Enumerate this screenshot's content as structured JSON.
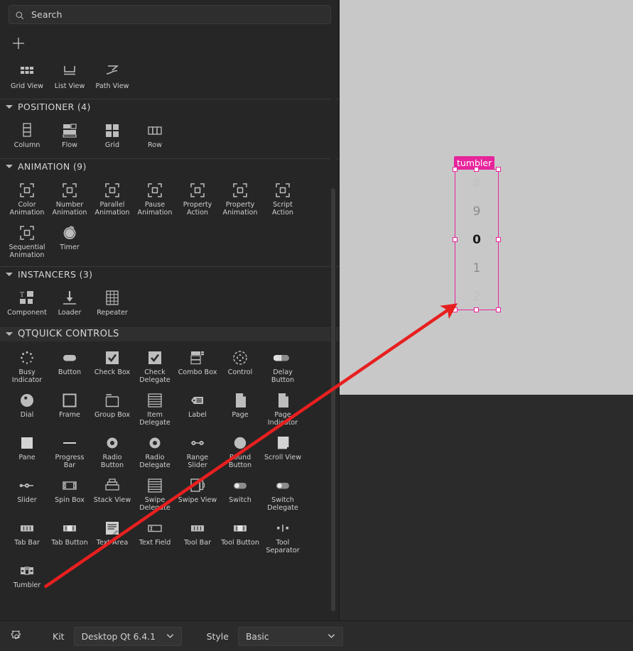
{
  "search": {
    "placeholder": "Search",
    "icon": "search-icon"
  },
  "toolbar": {
    "add_icon": "plus-icon"
  },
  "library": {
    "partial_top_row": {
      "items": [
        {
          "label": "Grid View",
          "icon": "grid-view-icon"
        },
        {
          "label": "List View",
          "icon": "list-view-icon"
        },
        {
          "label": "Path View",
          "icon": "path-view-icon"
        }
      ]
    },
    "sections": [
      {
        "title": "POSITIONER (4)",
        "expanded": true,
        "items": [
          {
            "label": "Column",
            "icon": "column-icon"
          },
          {
            "label": "Flow",
            "icon": "flow-icon"
          },
          {
            "label": "Grid",
            "icon": "grid-icon"
          },
          {
            "label": "Row",
            "icon": "row-icon"
          }
        ]
      },
      {
        "title": "ANIMATION (9)",
        "expanded": true,
        "items": [
          {
            "label": "Color Animation",
            "icon": "animation-bracket-icon"
          },
          {
            "label": "Number Animation",
            "icon": "animation-bracket-icon"
          },
          {
            "label": "Parallel Animation",
            "icon": "animation-bracket-icon"
          },
          {
            "label": "Pause Animation",
            "icon": "animation-bracket-icon"
          },
          {
            "label": "Property Action",
            "icon": "animation-bracket-icon"
          },
          {
            "label": "Property Animation",
            "icon": "animation-bracket-icon"
          },
          {
            "label": "Script Action",
            "icon": "animation-bracket-icon"
          },
          {
            "label": "Sequential Animation",
            "icon": "animation-bracket-icon"
          },
          {
            "label": "Timer",
            "icon": "timer-icon"
          }
        ]
      },
      {
        "title": "INSTANCERS (3)",
        "expanded": true,
        "items": [
          {
            "label": "Component",
            "icon": "component-icon"
          },
          {
            "label": "Loader",
            "icon": "loader-icon"
          },
          {
            "label": "Repeater",
            "icon": "repeater-icon"
          }
        ]
      },
      {
        "title": "QTQUICK CONTROLS",
        "expanded": true,
        "items": [
          {
            "label": "Busy Indicator",
            "icon": "busy-indicator-icon"
          },
          {
            "label": "Button",
            "icon": "button-icon"
          },
          {
            "label": "Check Box",
            "icon": "check-box-icon"
          },
          {
            "label": "Check Delegate",
            "icon": "check-delegate-icon"
          },
          {
            "label": "Combo Box",
            "icon": "combo-box-icon"
          },
          {
            "label": "Control",
            "icon": "control-icon"
          },
          {
            "label": "Delay Button",
            "icon": "delay-button-icon"
          },
          {
            "label": "Dial",
            "icon": "dial-icon"
          },
          {
            "label": "Frame",
            "icon": "frame-icon"
          },
          {
            "label": "Group Box",
            "icon": "group-box-icon"
          },
          {
            "label": "Item Delegate",
            "icon": "item-delegate-icon"
          },
          {
            "label": "Label",
            "icon": "label-icon"
          },
          {
            "label": "Page",
            "icon": "page-icon"
          },
          {
            "label": "Page Indicator",
            "icon": "page-indicator-icon"
          },
          {
            "label": "Pane",
            "icon": "pane-icon"
          },
          {
            "label": "Progress Bar",
            "icon": "progress-bar-icon"
          },
          {
            "label": "Radio Button",
            "icon": "radio-button-icon"
          },
          {
            "label": "Radio Delegate",
            "icon": "radio-delegate-icon"
          },
          {
            "label": "Range Slider",
            "icon": "range-slider-icon"
          },
          {
            "label": "Round Button",
            "icon": "round-button-icon"
          },
          {
            "label": "Scroll View",
            "icon": "scroll-view-icon"
          },
          {
            "label": "Slider",
            "icon": "slider-icon"
          },
          {
            "label": "Spin Box",
            "icon": "spin-box-icon"
          },
          {
            "label": "Stack View",
            "icon": "stack-view-icon"
          },
          {
            "label": "Swipe Delegate",
            "icon": "swipe-delegate-icon"
          },
          {
            "label": "Swipe View",
            "icon": "swipe-view-icon"
          },
          {
            "label": "Switch",
            "icon": "switch-icon"
          },
          {
            "label": "Switch Delegate",
            "icon": "switch-delegate-icon"
          },
          {
            "label": "Tab Bar",
            "icon": "tab-bar-icon"
          },
          {
            "label": "Tab Button",
            "icon": "tab-button-icon"
          },
          {
            "label": "Text Area",
            "icon": "text-area-icon"
          },
          {
            "label": "Text Field",
            "icon": "text-field-icon"
          },
          {
            "label": "Tool Bar",
            "icon": "tool-bar-icon"
          },
          {
            "label": "Tool Button",
            "icon": "tool-button-icon"
          },
          {
            "label": "Tool Separator",
            "icon": "tool-separator-icon"
          },
          {
            "label": "Tumbler",
            "icon": "tumbler-icon"
          }
        ]
      }
    ]
  },
  "canvas": {
    "selection": {
      "label": "tumbler",
      "accent_color": "#e6249b",
      "handle_color": "#ffffff"
    },
    "tumbler": {
      "values": [
        "8",
        "9",
        "0",
        "1",
        "2"
      ],
      "current_index": 2,
      "background": "#c8c8c8"
    },
    "background": "#c8c8c8"
  },
  "annotation": {
    "arrow_color": "#e81f1f",
    "from": "tumbler-library-item",
    "to": "tumbler-on-canvas"
  },
  "bottom_bar": {
    "settings_icon": "gear-icon",
    "kit_label": "Kit",
    "kit_value": "Desktop Qt 6.4.1",
    "style_label": "Style",
    "style_value": "Basic"
  }
}
